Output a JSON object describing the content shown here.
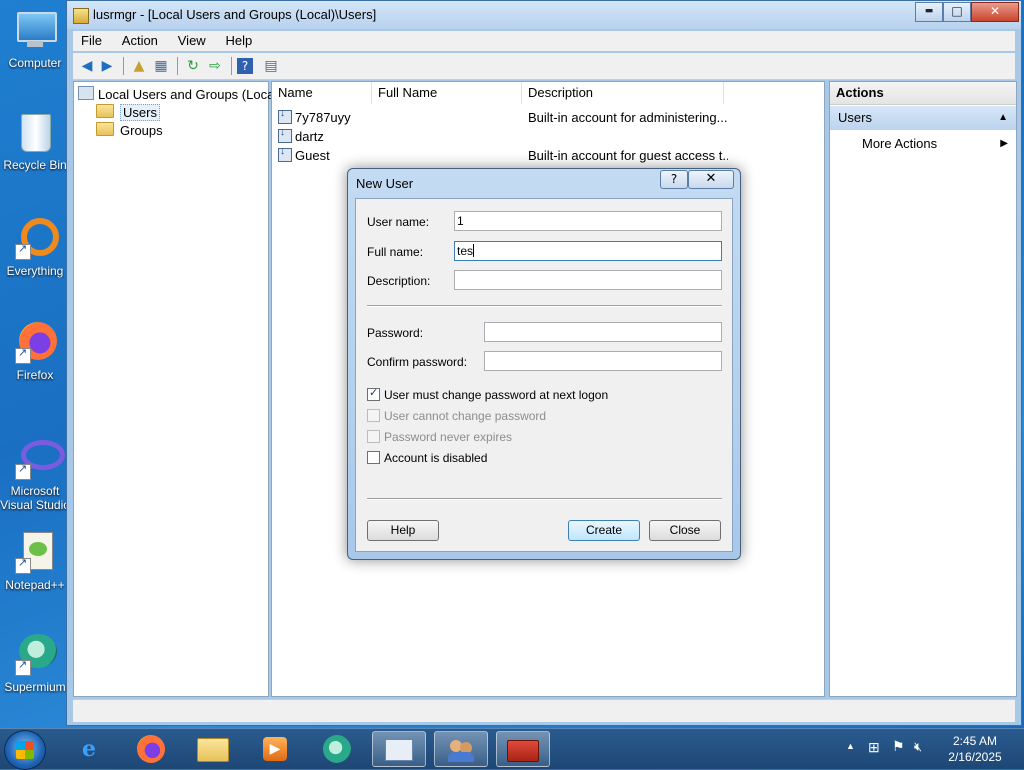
{
  "desktop": {
    "icons": [
      {
        "label": "Computer",
        "icon": "computer-icon"
      },
      {
        "label": "Recycle Bin",
        "icon": "recycle-bin-icon"
      },
      {
        "label": "Everything",
        "icon": "everything-icon"
      },
      {
        "label": "Firefox",
        "icon": "firefox-icon"
      },
      {
        "label": "Microsoft Visual Studio",
        "icon": "visual-studio-icon"
      },
      {
        "label": "Notepad++",
        "icon": "notepad-plus-plus-icon"
      },
      {
        "label": "Supermium",
        "icon": "supermium-icon"
      }
    ]
  },
  "window": {
    "title": "lusrmgr - [Local Users and Groups (Local)\\Users]",
    "controls": {
      "minimize": "▬",
      "maximize": "□",
      "close": "✕"
    }
  },
  "menu": {
    "file": "File",
    "action": "Action",
    "view": "View",
    "help": "Help"
  },
  "tree": {
    "root": "Local Users and Groups (Local)",
    "users": "Users",
    "groups": "Groups"
  },
  "list": {
    "columns": {
      "name": "Name",
      "full_name": "Full Name",
      "description": "Description"
    },
    "rows": [
      {
        "name": "7y787uyy",
        "full_name": "",
        "description": "Built-in account for administering..."
      },
      {
        "name": "dartz",
        "full_name": "",
        "description": ""
      },
      {
        "name": "Guest",
        "full_name": "",
        "description": "Built-in account for guest access t..."
      }
    ]
  },
  "actions": {
    "header": "Actions",
    "section": "Users",
    "more": "More Actions"
  },
  "dialog": {
    "title": "New User",
    "help_glyph": "?",
    "close_glyph": "✕",
    "labels": {
      "user_name": "User name:",
      "full_name": "Full name:",
      "description": "Description:",
      "password": "Password:",
      "confirm_password": "Confirm password:"
    },
    "values": {
      "user_name": "1",
      "full_name": "tes",
      "description": "",
      "password": "",
      "confirm_password": ""
    },
    "checkboxes": {
      "must_change": {
        "label": "User must change password at next logon",
        "checked": true,
        "enabled": true
      },
      "cannot_change": {
        "label": "User cannot change password",
        "checked": false,
        "enabled": false
      },
      "never_expires": {
        "label": "Password never expires",
        "checked": false,
        "enabled": false
      },
      "disabled": {
        "label": "Account is disabled",
        "checked": false,
        "enabled": true
      }
    },
    "buttons": {
      "help": "Help",
      "create": "Create",
      "close": "Close"
    }
  },
  "taskbar": {
    "apps": [
      "internet-explorer-icon",
      "firefox-icon",
      "file-explorer-icon",
      "media-player-icon",
      "supermium-icon",
      "control-panel-icon",
      "users-icon",
      "toolbox-icon"
    ],
    "clock": {
      "time": "2:45 AM",
      "date": "2/16/2025"
    }
  }
}
